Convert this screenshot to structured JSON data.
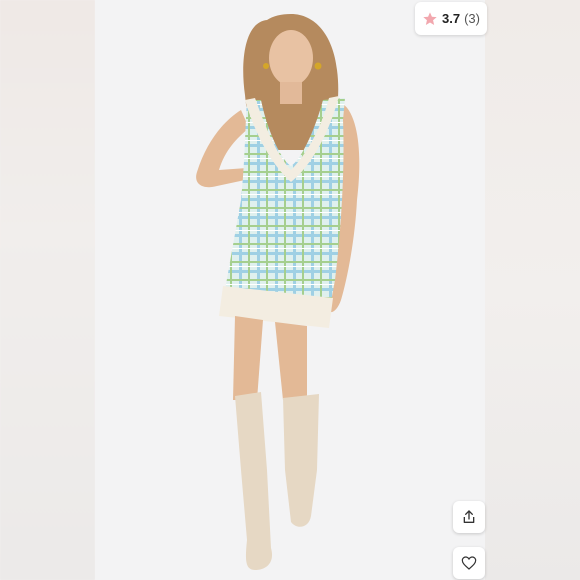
{
  "rating": {
    "value": "3.7",
    "count": "(3)",
    "star_color": "#f2a7ae"
  },
  "actions": {
    "share_icon": "share-icon",
    "like_icon": "heart-icon"
  },
  "product_photo": {
    "dress_colors": [
      "#a9d6e6",
      "#7fc4c0",
      "#d7e8c3"
    ],
    "trim_color": "#f3ede1",
    "boot_color": "#e6d8c4"
  }
}
